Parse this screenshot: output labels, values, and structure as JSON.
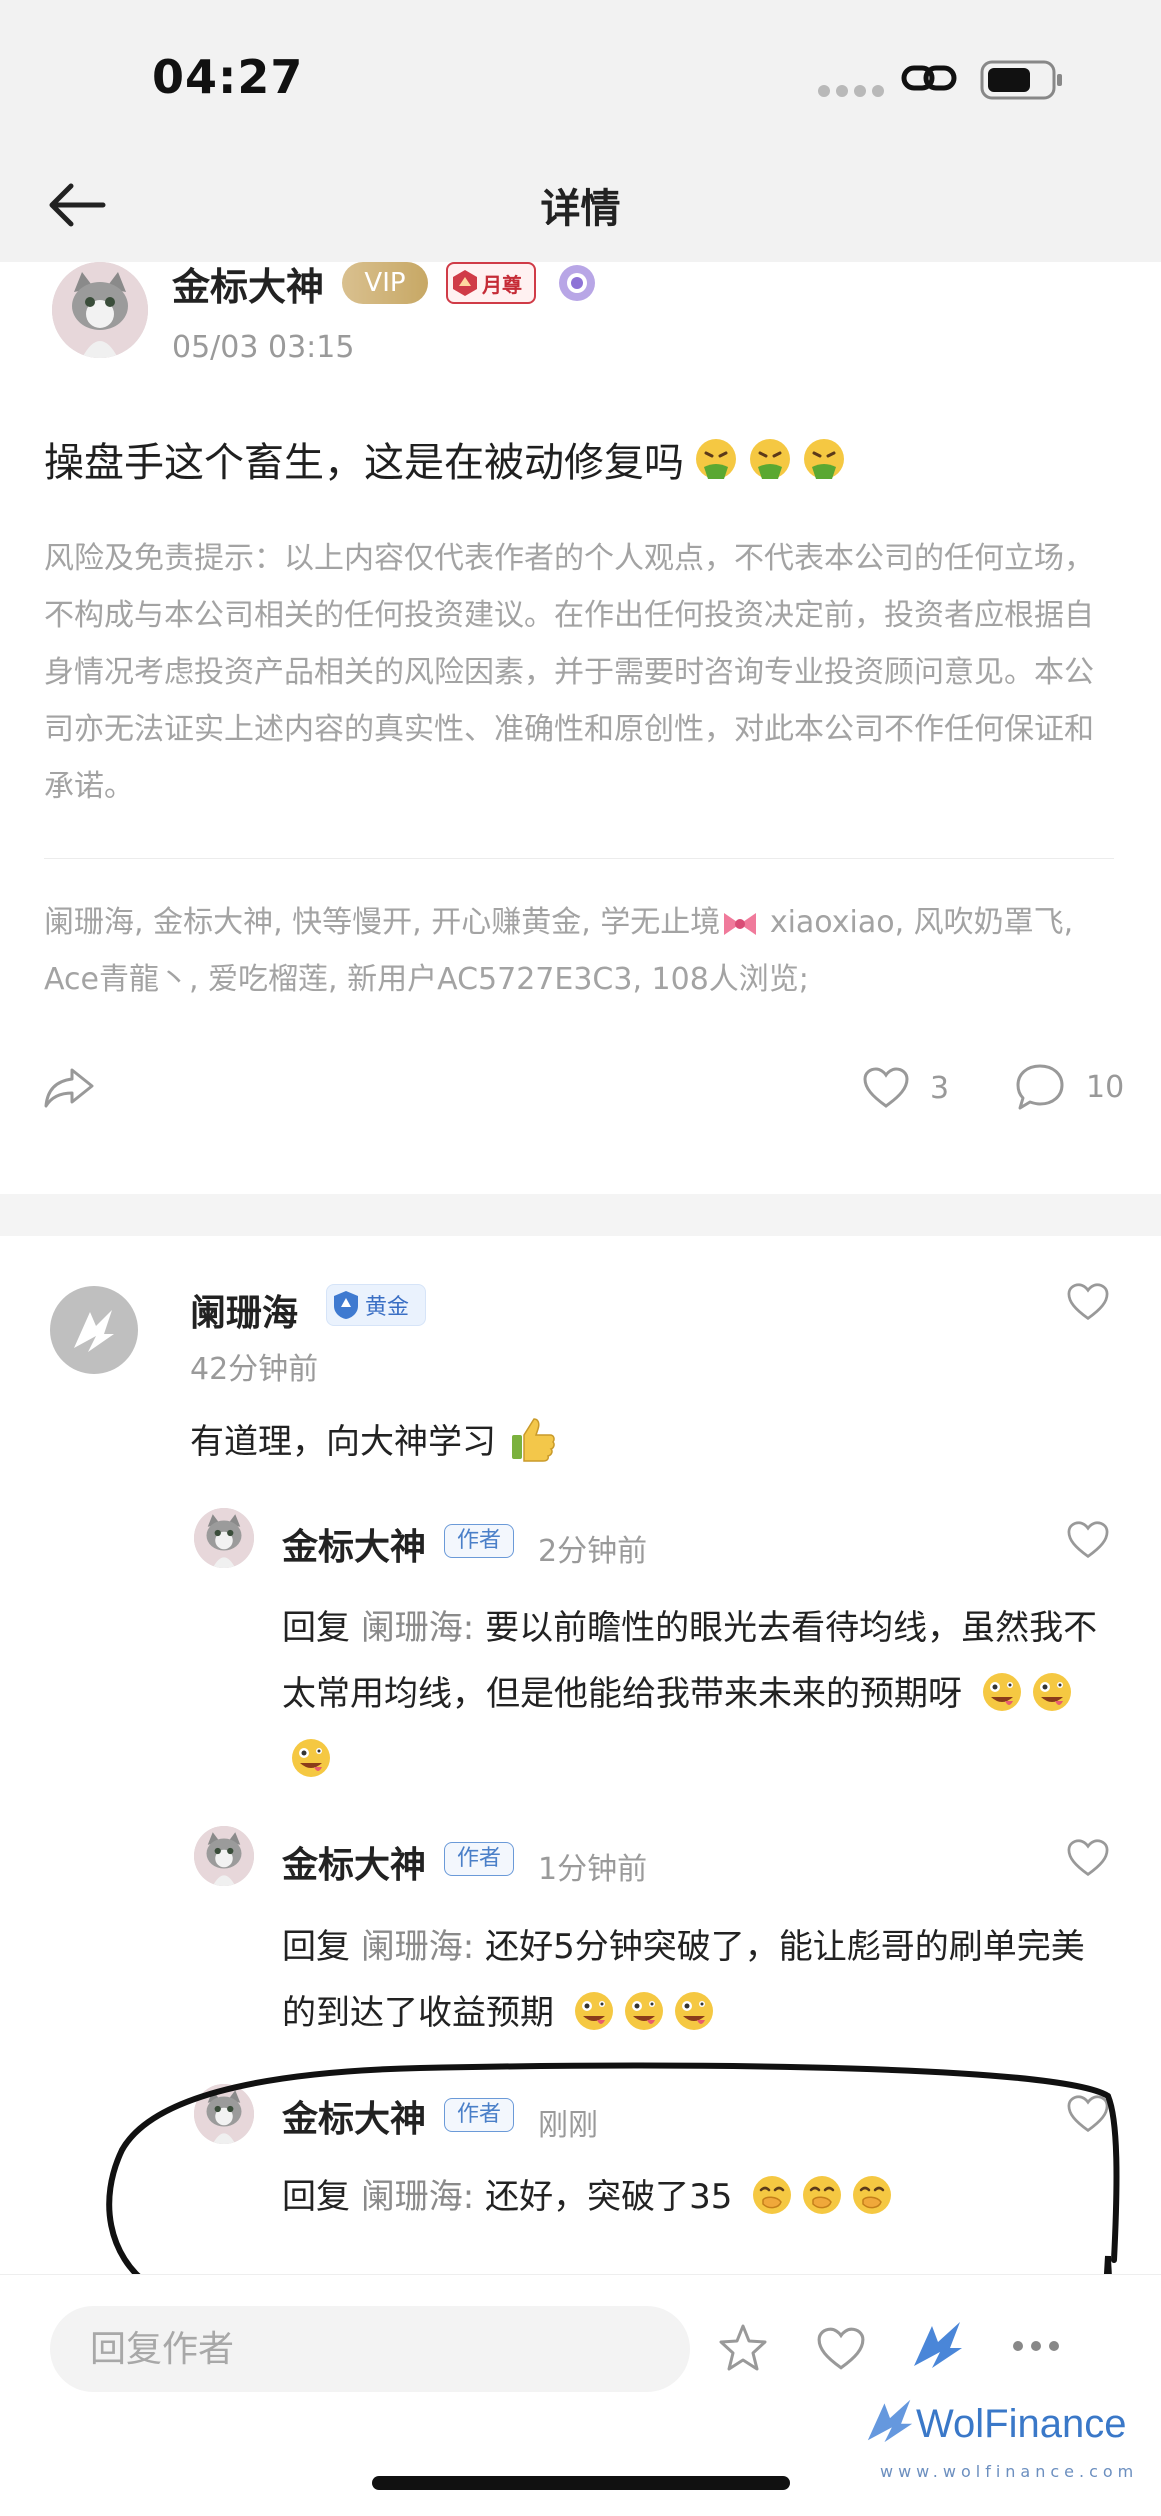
{
  "status_bar": {
    "time": "04:27"
  },
  "nav": {
    "title": "详情"
  },
  "post": {
    "author": "金标大神",
    "vip_label": "VIP",
    "rank_label": "月尊",
    "time": "05/03 03:15",
    "text": "操盘手这个畜生，这是在被动修复吗",
    "disclaimer": "风险及免责提示：以上内容仅代表作者的个人观点，不代表本公司的任何立场，不构成与本公司相关的任何投资建议。在作出任何投资决定前，投资者应根据自身情况考虑投资产品相关的风险因素，并于需要时咨询专业投资顾问意见。本公司亦无法证实上述内容的真实性、准确性和原创性，对此本公司不作任何保证和承诺。",
    "viewers_part1": "阑珊海, 金标大神, 快等慢开, 开心赚黄金, 学无止境",
    "viewers_part2": " xiaoxiao, 风吹奶罩飞, Ace青龍丶, 爱吃榴莲, 新用户AC5727E3C3, 108人浏览;",
    "like_count": "3",
    "comment_count": "10"
  },
  "comment": {
    "author": "阑珊海",
    "badge": "黄金",
    "time": "42分钟前",
    "text": "有道理，向大神学习"
  },
  "replies": [
    {
      "author": "金标大神",
      "tag": "作者",
      "time": "2分钟前",
      "prefix": "回复",
      "reply_to": "阑珊海:",
      "text": "要以前瞻性的眼光去看待均线，虽然我不太常用均线，但是他能给我带来未来的预期呀"
    },
    {
      "author": "金标大神",
      "tag": "作者",
      "time": "1分钟前",
      "prefix": "回复",
      "reply_to": "阑珊海:",
      "text": "还好5分钟突破了，能让彪哥的刷单完美的到达了收益预期"
    },
    {
      "author": "金标大神",
      "tag": "作者",
      "time": "刚刚",
      "prefix": "回复",
      "reply_to": "阑珊海:",
      "text": "还好，突破了35"
    }
  ],
  "bottom_bar": {
    "reply_placeholder": "回复作者"
  },
  "watermark": {
    "brand": "WolFinance",
    "url": "www.wolfinance.com"
  },
  "colors": {
    "accent_blue": "#4a7fc8",
    "vip_gold": "#c9ab6b",
    "muted_text": "#a3a3a3"
  }
}
